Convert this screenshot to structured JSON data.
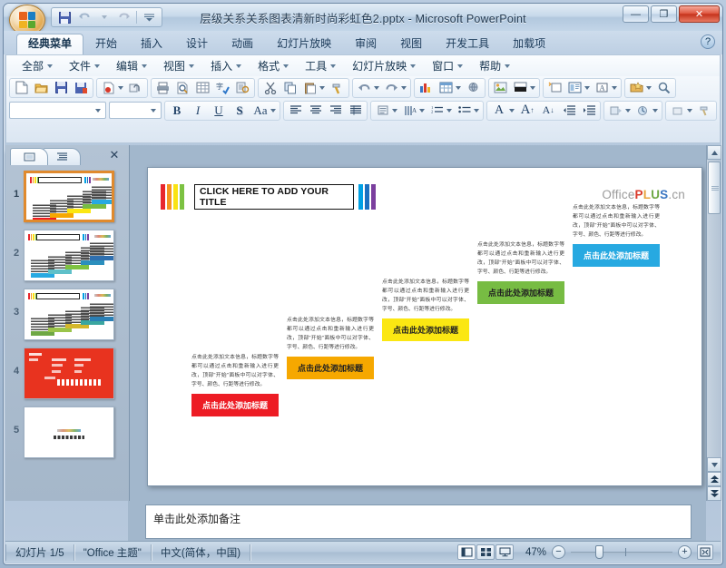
{
  "window": {
    "title": "层级关系关系图表清新时尚彩虹色2.pptx - Microsoft PowerPoint",
    "minimize": "—",
    "maximize": "❐",
    "close": "✕"
  },
  "quick_access": {
    "save": "save-icon",
    "undo": "undo-icon",
    "redo": "redo-icon",
    "customize": "customize-icon"
  },
  "ribbon": {
    "tabs": [
      {
        "label": "经典菜单",
        "active": true
      },
      {
        "label": "开始",
        "active": false
      },
      {
        "label": "插入",
        "active": false
      },
      {
        "label": "设计",
        "active": false
      },
      {
        "label": "动画",
        "active": false
      },
      {
        "label": "幻灯片放映",
        "active": false
      },
      {
        "label": "审阅",
        "active": false
      },
      {
        "label": "视图",
        "active": false
      },
      {
        "label": "开发工具",
        "active": false
      },
      {
        "label": "加载项",
        "active": false
      }
    ],
    "help": "?"
  },
  "menubar": {
    "items": [
      {
        "label": "全部"
      },
      {
        "label": "文件"
      },
      {
        "label": "编辑"
      },
      {
        "label": "视图"
      },
      {
        "label": "插入"
      },
      {
        "label": "格式"
      },
      {
        "label": "工具"
      },
      {
        "label": "幻灯片放映"
      },
      {
        "label": "窗口"
      },
      {
        "label": "帮助"
      }
    ]
  },
  "toolbar": {
    "row1": [
      "new-document-icon",
      "open-folder-icon",
      "save-icon",
      "save-as-icon",
      "print-preview-pdf-icon",
      "attach-icon",
      "print-icon",
      "print-preview-icon",
      "table-icon",
      "spellcheck-icon",
      "research-icon",
      "cut-icon",
      "copy-icon",
      "paste-icon",
      "format-painter-icon",
      "undo-icon",
      "redo-icon",
      "chart-icon",
      "insert-table-icon",
      "hyperlink-icon",
      "insert-picture-icon",
      "slide-design-icon",
      "new-slide-icon",
      "slide-layout-icon",
      "text-box-icon",
      "insert-object-icon",
      "zoom-icon"
    ],
    "row2": {
      "font_name": "",
      "font_size": "",
      "bold": "B",
      "italic": "I",
      "underline": "U",
      "shadow": "S",
      "change_case": "Aa",
      "align_left": "align-left-icon",
      "align_center": "align-center-icon",
      "align_right": "align-right-icon",
      "align_justify": "align-justify-icon",
      "line_spacing": "line-spacing-icon",
      "text_direction": "text-direction-icon",
      "numbered_list": "numbered-list-icon",
      "bulleted_list": "bulleted-list-icon",
      "font_color": "font-color-icon",
      "increase_font": "increase-font-icon",
      "decrease_font": "decrease-font-icon",
      "decrease_indent": "decrease-indent-icon",
      "increase_indent": "increase-indent-icon",
      "animation": "animation-icon",
      "custom-animation": "custom-animation-icon",
      "shape_fill": "shape-fill-icon"
    }
  },
  "thumb_pane": {
    "tab_slides": "slides-tab-icon",
    "tab_outline": "outline-tab-icon",
    "close": "✕",
    "slides": [
      {
        "number": "1",
        "selected": true,
        "kind": "rainbow-steps"
      },
      {
        "number": "2",
        "selected": false,
        "kind": "rainbow-steps"
      },
      {
        "number": "3",
        "selected": false,
        "kind": "rainbow-steps"
      },
      {
        "number": "4",
        "selected": false,
        "kind": "red"
      },
      {
        "number": "5",
        "selected": false,
        "kind": "blank"
      }
    ]
  },
  "slide": {
    "title_placeholder": "CLICK HERE TO ADD YOUR TITLE",
    "left_bars": [
      "#e8262d",
      "#f5941f",
      "#f9e313",
      "#7cc242"
    ],
    "right_bars": [
      "#00a0e4",
      "#1b6fc0",
      "#7b3f9e"
    ],
    "logo": {
      "office": "Office",
      "plus": "PLUS",
      "cn": ".cn"
    },
    "body_text": "点击此处添加文本信息，标题数字等都可以通过点击和重新输入进行更改，顶部\"开始\"面板中可以对字体、字号、颜色、行距等进行修改。",
    "steps": [
      {
        "label": "点击此处添加标题",
        "color": "#ed1c24",
        "text_color": "#ffffff"
      },
      {
        "label": "点击此处添加标题",
        "color": "#f6a800",
        "text_color": "#222222"
      },
      {
        "label": "点击此处添加标题",
        "color": "#fbe712",
        "text_color": "#222222"
      },
      {
        "label": "点击此处添加标题",
        "color": "#77bc43",
        "text_color": "#222222"
      },
      {
        "label": "点击此处添加标题",
        "color": "#27a9e1",
        "text_color": "#ffffff"
      }
    ]
  },
  "notes": {
    "placeholder": "单击此处添加备注"
  },
  "statusbar": {
    "slide_counter": "幻灯片 1/5",
    "theme": "\"Office 主题\"",
    "language": "中文(简体，中国)",
    "view_normal": "normal-view-icon",
    "view_sorter": "slide-sorter-icon",
    "view_show": "slideshow-view-icon",
    "zoom_level": "47%",
    "zoom_out": "−",
    "zoom_in": "+",
    "fit_window": "fit-to-window-icon"
  },
  "scrollbar": {
    "up": "▲",
    "down": "▼",
    "prev_slide": "prev-slide-icon",
    "next_slide": "next-slide-icon"
  }
}
